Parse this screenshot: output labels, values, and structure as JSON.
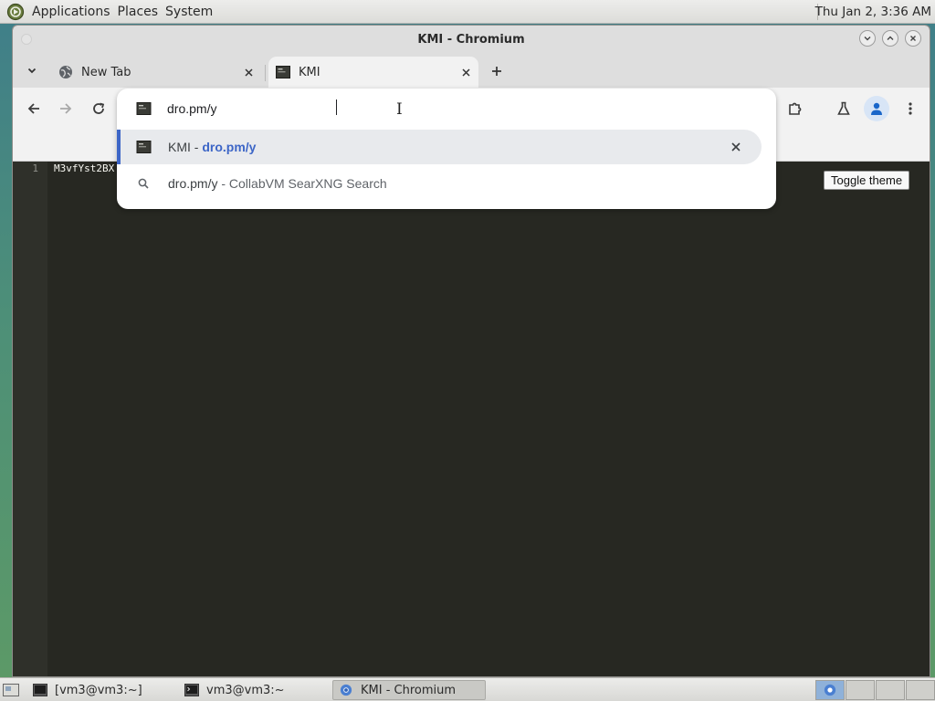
{
  "top_panel": {
    "menus": [
      "Applications",
      "Places",
      "System"
    ],
    "clock": "Thu Jan  2,  3:36 AM"
  },
  "window": {
    "title": "KMI - Chromium"
  },
  "tabs": [
    {
      "label": "New Tab",
      "icon": "globe-icon",
      "active": false
    },
    {
      "label": "KMI",
      "icon": "kmi-favicon",
      "active": true
    }
  ],
  "omnibox": {
    "input_value": "dro.pm/y",
    "suggestions": [
      {
        "prefix": "KMI - ",
        "url": "dro.pm/y",
        "type": "history",
        "selected": true
      },
      {
        "query": "dro.pm/y",
        "suffix": " - CollabVM SearXNG Search",
        "type": "search",
        "selected": false
      }
    ]
  },
  "editor": {
    "line_numbers": [
      "1"
    ],
    "lines": [
      "M3vfYst2BX"
    ],
    "toggle_label": "Toggle theme"
  },
  "taskbar": {
    "items": [
      {
        "label": "[vm3@vm3:~]",
        "icon": "terminal-icon",
        "active": false
      },
      {
        "label": "vm3@vm3:~",
        "icon": "terminal-icon",
        "active": false
      },
      {
        "label": "KMI - Chromium",
        "icon": "chromium-icon",
        "active": true
      }
    ]
  },
  "colors": {
    "accent": "#3d66c7",
    "editor_bg": "#272822",
    "gutter_bg": "#2f302a"
  }
}
